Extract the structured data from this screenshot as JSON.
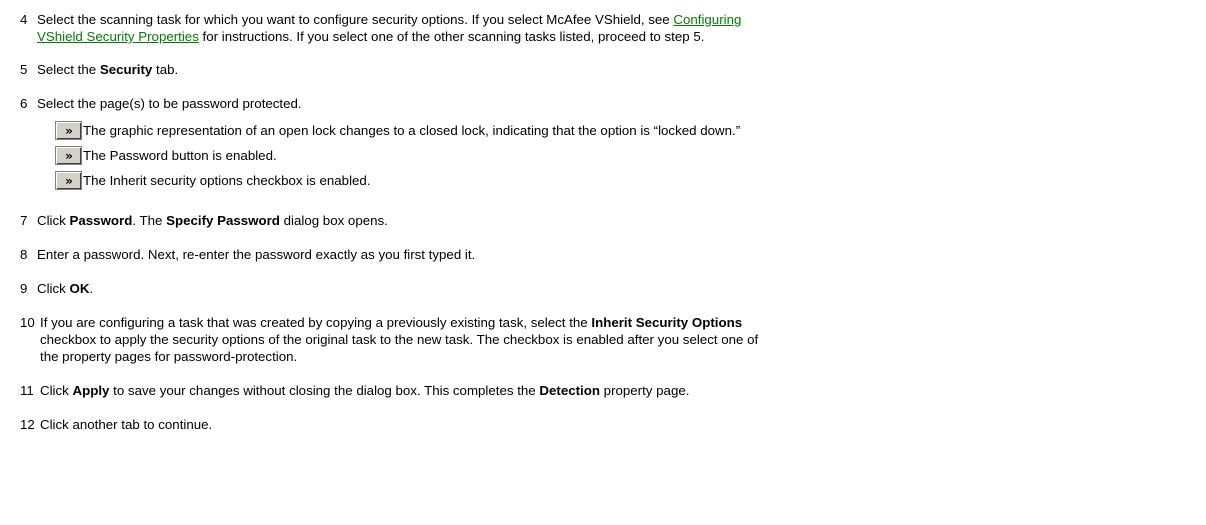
{
  "steps": {
    "s4": {
      "num": "4",
      "pre": "Select the scanning task for which you want to configure security options. If you select McAfee VShield, see ",
      "link1": "Configuring",
      "link2": "VShield Security Properties",
      "post": " for instructions. If you select one of the other scanning tasks listed, proceed to step 5."
    },
    "s5": {
      "num": "5",
      "pre": "Select the ",
      "b1": "Security",
      "post": " tab."
    },
    "s6": {
      "num": "6",
      "text": "Select the page(s) to be password protected."
    },
    "s7": {
      "num": "7",
      "pre": "Click ",
      "b1": "Password",
      "mid": ". The ",
      "b2": "Specify Password",
      "post": " dialog box opens."
    },
    "s8": {
      "num": "8",
      "text": "Enter a password. Next, re-enter the password exactly as you first typed it."
    },
    "s9": {
      "num": "9",
      "pre": "Click ",
      "b1": "OK",
      "post": "."
    },
    "s10": {
      "num": "10",
      "pre": "If you are configuring a task that was created by copying a previously existing task, select the ",
      "b1": "Inherit Security Options",
      "line2": "checkbox to apply the security options of the original task to the new task. The checkbox is enabled after you select one of",
      "line3": "the property pages for password-protection."
    },
    "s11": {
      "num": "11",
      "pre": "Click ",
      "b1": "Apply",
      "mid": " to save your changes without closing the dialog box. This completes the ",
      "b2": "Detection",
      "post": " property page."
    },
    "s12": {
      "num": "12",
      "text": "Click another tab to continue."
    }
  },
  "notes": [
    {
      "icon": "double-chevron-right-icon",
      "glyph": "»",
      "text": "The graphic representation of an open lock changes to a closed lock, indicating that the option is “locked down.”"
    },
    {
      "icon": "double-chevron-right-icon",
      "glyph": "»",
      "text": "The Password button is enabled."
    },
    {
      "icon": "double-chevron-right-icon",
      "glyph": "»",
      "text": "The Inherit security options checkbox is enabled."
    }
  ],
  "colors": {
    "link": "#008000",
    "icon_bg": "#d4d0c8"
  }
}
